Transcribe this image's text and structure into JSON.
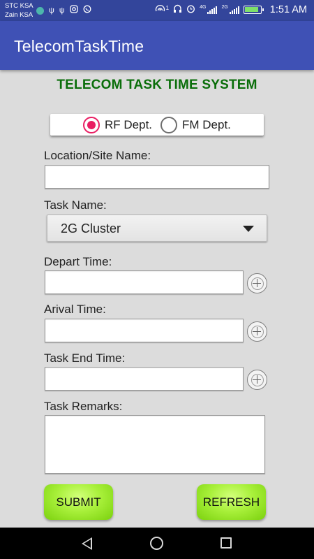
{
  "status_bar": {
    "carrier_1": "STC KSA",
    "carrier_2": "Zain KSA",
    "signal_1_label": "4G",
    "signal_2_label": "2G",
    "hotspot_badge": "1",
    "time": "1:51 AM",
    "icons_left": [
      "app-notification-icon",
      "usb-icon",
      "usb-icon",
      "instagram-icon",
      "whatsapp-icon"
    ],
    "icons_right": [
      "hotspot-icon",
      "headset-icon",
      "alarm-icon",
      "signal-icon",
      "signal-icon",
      "battery-icon"
    ]
  },
  "app_bar": {
    "title": "TelecomTaskTime"
  },
  "form": {
    "heading": "TELECOM TASK TIME SYSTEM",
    "department": {
      "options": [
        "RF Dept.",
        "FM Dept."
      ],
      "selected": "RF Dept."
    },
    "location_label": "Location/Site Name:",
    "location_value": "",
    "task_name_label": "Task Name:",
    "task_name_selected": "2G Cluster",
    "depart_label": "Depart Time:",
    "depart_value": "",
    "arrival_label": "Arival Time:",
    "arrival_value": "",
    "end_label": "Task End Time:",
    "end_value": "",
    "remarks_label": "Task Remarks:",
    "remarks_value": "",
    "submit_label": "SUBMIT",
    "refresh_label": "REFRESH"
  },
  "colors": {
    "status_bar": "#33459b",
    "app_bar": "#3f51b5",
    "heading": "#0a6e0a",
    "radio_accent": "#e91e63",
    "button_green": "#a8f03a",
    "background": "#dcdcdc"
  },
  "nav_bar": {
    "icons": [
      "back-icon",
      "home-icon",
      "recent-apps-icon"
    ]
  }
}
